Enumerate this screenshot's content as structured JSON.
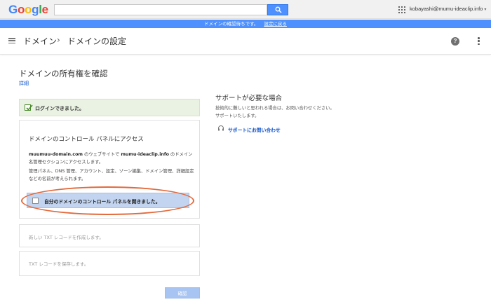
{
  "topbar": {
    "logo": [
      "G",
      "o",
      "o",
      "g",
      "l",
      "e"
    ],
    "account_email": "kobayashi@mumu-ideaclip.info",
    "icons": {
      "search": "search-icon",
      "apps": "apps-grid-icon",
      "account_caret": "caret-down-icon"
    }
  },
  "notice_bar": {
    "message": "ドメインの確認待ちです。",
    "link": "設定に戻る"
  },
  "header": {
    "breadcrumb": [
      "ドメイン",
      "›",
      "ドメインの設定"
    ],
    "icons": {
      "menu": "hamburger-menu-icon",
      "help": "help-icon",
      "more": "more-vert-icon"
    },
    "help_glyph": "?"
  },
  "main": {
    "title": "ドメインの所有権を確認",
    "details_link": "詳細",
    "success_message": "ログインできました。",
    "card_access": {
      "title": "ドメインのコントロール パネルにアクセス",
      "domain": "muumuu-domain.com",
      "text_a": " のウェブサイトで ",
      "target_domain": "mumu-ideaclip.info",
      "text_b": " のドメイン名管理セクションにアクセスします。",
      "hint": "管理パネル、DNS 管理、アカウント、設定、ゾーン編集、ドメイン管理、詳細設定などの名前が考えられます。",
      "checkbox_label": "自分のドメインのコントロール パネルを開きました。",
      "checkbox_checked": false
    },
    "step_txt_create": "新しい TXT レコードを作成します。",
    "step_txt_save": "TXT レコードを保存します。",
    "confirm_button": "確認"
  },
  "support": {
    "title": "サポートが必要な場合",
    "text": "技術的に難しいと思われる場合は、お問い合わせください。サポートいたします。",
    "link": "サポートにお問い合わせ",
    "icon": "headset-icon"
  },
  "colors": {
    "accent": "#4d90fe",
    "link": "#1155cc",
    "success_bg": "#eaf2e3",
    "highlight": "#e36a3c"
  }
}
